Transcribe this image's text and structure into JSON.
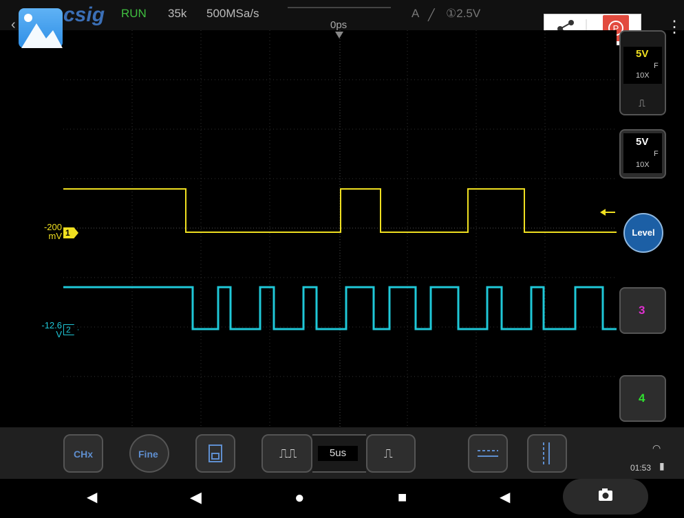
{
  "topbar": {
    "brand": "csig",
    "run_state": "RUN",
    "memory_depth": "35k",
    "sample_rate": "500MSa/s",
    "time_offset": "0ps",
    "trigger_mode": "A",
    "trigger_level": "①2.5V",
    "back_icon": "back-chevron-icon",
    "share_icon": "share-icon",
    "p_icon": "p-badge-icon",
    "menu_icon": "kebab-menu-icon"
  },
  "channels": {
    "ch1": {
      "offset_value": "-200",
      "offset_unit": "mV",
      "marker": "1",
      "color": "#f0e020",
      "vdiv": "5V",
      "probe": "10X",
      "coupling": "F"
    },
    "ch2": {
      "offset_value": "-12.6",
      "offset_unit": "V",
      "marker": "2",
      "color": "#1fc8d8",
      "vdiv": "5V",
      "probe": "10X",
      "coupling": "F"
    }
  },
  "side_buttons": {
    "level_label": "Level",
    "ch3_label": "3",
    "ch4_label": "4",
    "ch3_color": "#e030d0",
    "ch4_color": "#30e030"
  },
  "bottombar": {
    "chx_label": "CHx",
    "fine_label": "Fine",
    "timebase": "5us",
    "clock": "01:53",
    "save_icon": "save-icon",
    "zoom_out_icon": "wave-compress-icon",
    "zoom_in_icon": "wave-expand-icon",
    "h_cursor_icon": "horizontal-cursor-icon",
    "v_cursor_icon": "vertical-cursor-icon"
  },
  "navbar": {
    "icons": [
      "volume-down-icon",
      "back-icon",
      "home-icon",
      "recents-icon",
      "volume-up-icon",
      "camera-icon"
    ]
  }
}
